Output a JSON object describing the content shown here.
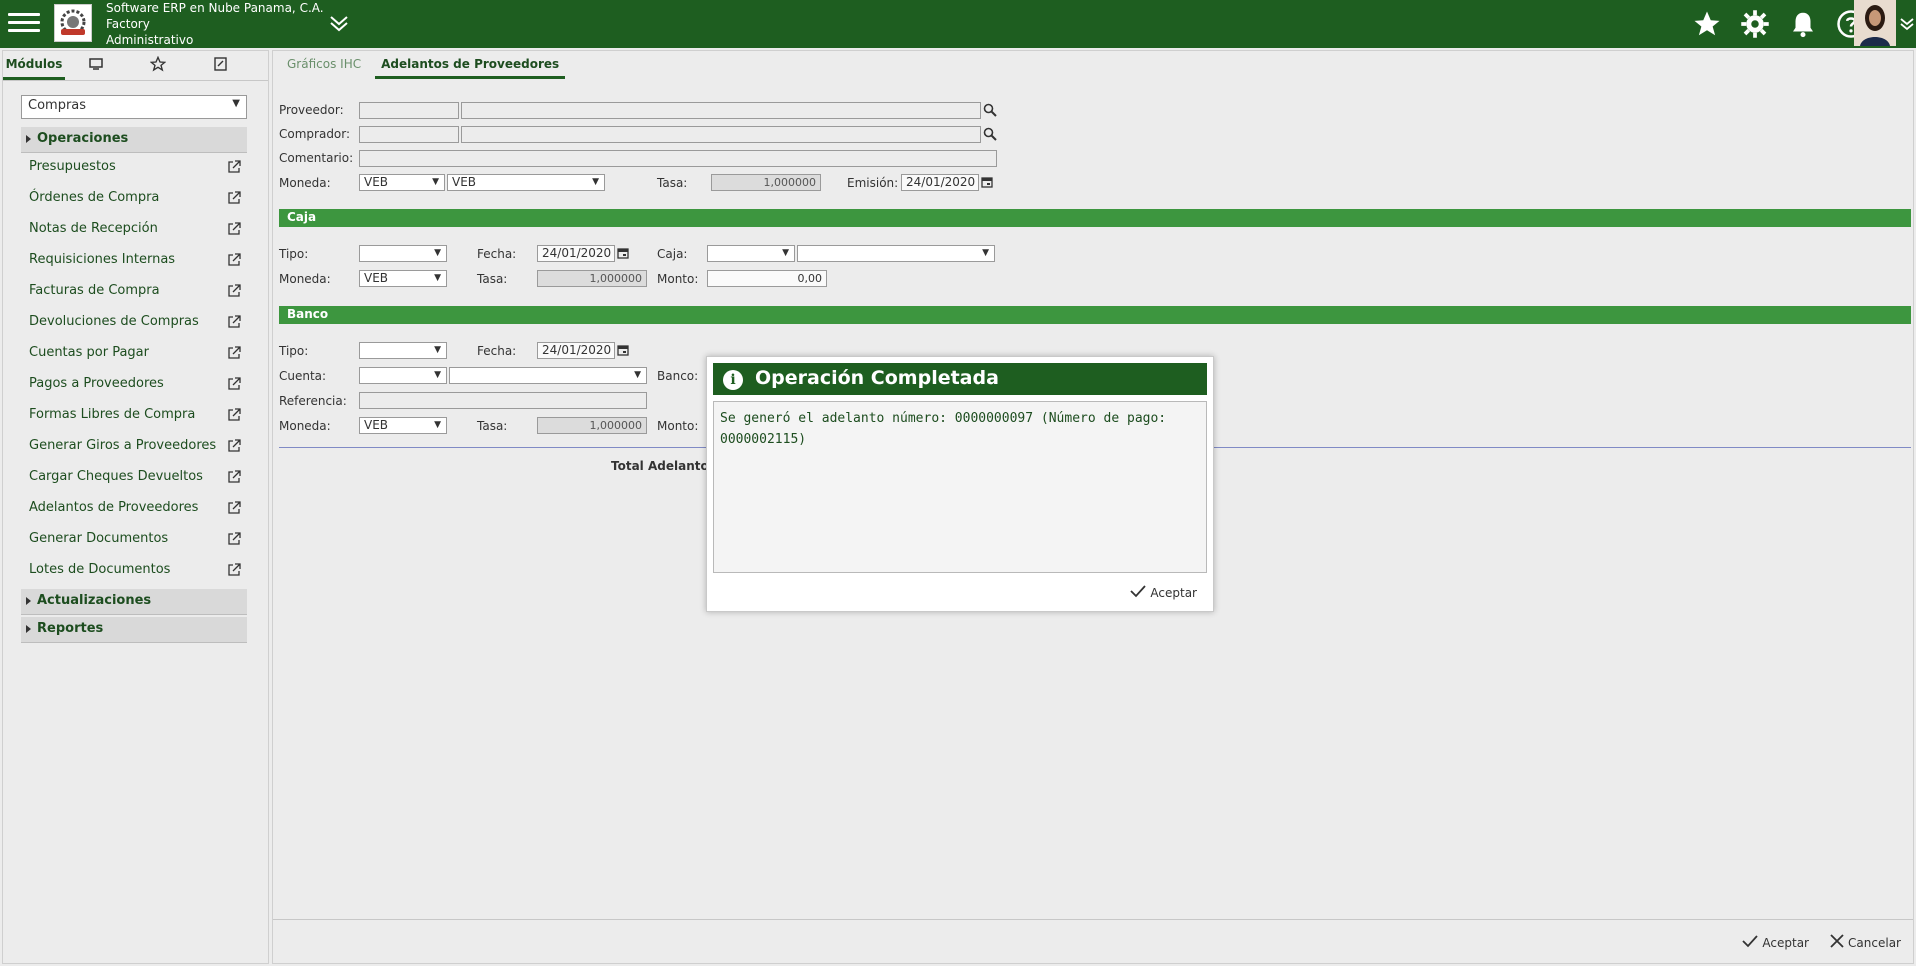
{
  "header": {
    "company_line1": "Software ERP en Nube Panama, C.A.",
    "company_line2": "Factory",
    "company_line3": "Administrativo",
    "icons": [
      "menu-icon",
      "company-logo",
      "chevron-down-icon",
      "star-icon",
      "gear-icon",
      "bell-icon",
      "help-icon",
      "avatar",
      "chevron-down-icon"
    ],
    "bar_color": "#1e5e20"
  },
  "sidebar": {
    "tabs": [
      {
        "label": "Módulos"
      },
      {
        "icon": "monitor-icon"
      },
      {
        "icon": "star-outline-icon"
      },
      {
        "icon": "document-icon"
      }
    ],
    "module_selected": "Compras",
    "groups": {
      "operaciones": "Operaciones",
      "actualizaciones": "Actualizaciones",
      "reportes": "Reportes"
    },
    "items": [
      {
        "label": "Presupuestos"
      },
      {
        "label": "Órdenes de Compra"
      },
      {
        "label": "Notas de Recepción"
      },
      {
        "label": "Requisiciones Internas"
      },
      {
        "label": "Facturas de Compra"
      },
      {
        "label": "Devoluciones de Compras"
      },
      {
        "label": "Cuentas por Pagar"
      },
      {
        "label": "Pagos a Proveedores"
      },
      {
        "label": "Formas Libres de Compra"
      },
      {
        "label": "Generar Giros a Proveedores"
      },
      {
        "label": "Cargar Cheques Devueltos"
      },
      {
        "label": "Adelantos de Proveedores"
      },
      {
        "label": "Generar Documentos"
      },
      {
        "label": "Lotes de Documentos"
      }
    ]
  },
  "main": {
    "tabs": [
      {
        "label": "Gráficos IHC"
      },
      {
        "label": "Adelantos de Proveedores"
      }
    ],
    "form": {
      "proveedor_label": "Proveedor:",
      "comprador_label": "Comprador:",
      "comentario_label": "Comentario:",
      "moneda_label": "Moneda:",
      "moneda_code": "VEB",
      "moneda_name": "VEB",
      "tasa_label": "Tasa:",
      "tasa_value": "1,000000",
      "emision_label": "Emisión:",
      "emision_value": "24/01/2020"
    },
    "caja": {
      "title": "Caja",
      "tipo_label": "Tipo:",
      "fecha_label": "Fecha:",
      "fecha_value": "24/01/2020",
      "caja_label": "Caja:",
      "moneda_label": "Moneda:",
      "moneda_value": "VEB",
      "tasa_label": "Tasa:",
      "tasa_value": "1,000000",
      "monto_label": "Monto:",
      "monto_value": "0,00"
    },
    "banco": {
      "title": "Banco",
      "tipo_label": "Tipo:",
      "fecha_label": "Fecha:",
      "fecha_value": "24/01/2020",
      "cuenta_label": "Cuenta:",
      "banco_label": "Banco:",
      "referencia_label": "Referencia:",
      "moneda_label": "Moneda:",
      "moneda_value": "VEB",
      "tasa_label": "Tasa:",
      "tasa_value": "1,000000",
      "monto_label": "Monto:"
    },
    "total_label": "Total Adelanto:",
    "accept_label": "Aceptar",
    "cancel_label": "Cancelar",
    "section_color": "#3d963f"
  },
  "modal": {
    "title": "Operación Completada",
    "message": "Se generó el adelanto número: 0000000097 (Número de pago: 0000002115)",
    "button": "Aceptar"
  }
}
